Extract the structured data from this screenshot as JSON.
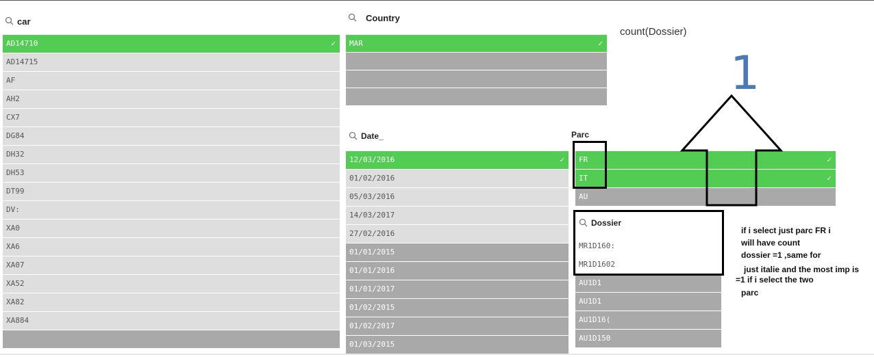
{
  "car": {
    "title": "car",
    "items": [
      {
        "label": "AD14710",
        "state": "selected"
      },
      {
        "label": "AD14715",
        "state": "alt"
      },
      {
        "label": "AF",
        "state": "alt"
      },
      {
        "label": "AH2",
        "state": "alt"
      },
      {
        "label": "CX7",
        "state": "alt"
      },
      {
        "label": "DG84",
        "state": "alt"
      },
      {
        "label": "DH32",
        "state": "alt"
      },
      {
        "label": "DH53",
        "state": "alt"
      },
      {
        "label": "DT99",
        "state": "alt"
      },
      {
        "label": "DV:",
        "state": "alt"
      },
      {
        "label": "XA0",
        "state": "alt"
      },
      {
        "label": "XA6",
        "state": "alt"
      },
      {
        "label": "XA07",
        "state": "alt"
      },
      {
        "label": "XA52",
        "state": "alt"
      },
      {
        "label": "XA82",
        "state": "alt"
      },
      {
        "label": "XA884",
        "state": "alt"
      },
      {
        "label": "",
        "state": "excluded"
      }
    ]
  },
  "country": {
    "title": "Country",
    "items": [
      {
        "label": "MAR",
        "state": "selected"
      },
      {
        "label": "",
        "state": "excluded"
      },
      {
        "label": "",
        "state": "excluded"
      },
      {
        "label": "",
        "state": "excluded"
      }
    ]
  },
  "date": {
    "title": "Date_",
    "items": [
      {
        "label": "12/03/2016",
        "state": "selected"
      },
      {
        "label": "01/02/2016",
        "state": "alt"
      },
      {
        "label": "05/03/2016",
        "state": "alt"
      },
      {
        "label": "14/03/2017",
        "state": "alt"
      },
      {
        "label": "27/02/2016",
        "state": "alt"
      },
      {
        "label": "01/01/2015",
        "state": "excluded"
      },
      {
        "label": "01/01/2016",
        "state": "excluded"
      },
      {
        "label": "01/01/2017",
        "state": "excluded"
      },
      {
        "label": "01/02/2015",
        "state": "excluded"
      },
      {
        "label": "01/02/2017",
        "state": "excluded"
      },
      {
        "label": "01/03/2015",
        "state": "excluded"
      }
    ]
  },
  "parc": {
    "title": "Parc",
    "items": [
      {
        "label": "FR",
        "state": "selected"
      },
      {
        "label": "IT",
        "state": "selected"
      },
      {
        "label": "AU",
        "state": "excluded"
      }
    ]
  },
  "dossier": {
    "title": "Dossier",
    "items": [
      {
        "label": "MR1D160:",
        "state": "white"
      },
      {
        "label": "MR1D1602",
        "state": "white"
      },
      {
        "label": "AU1D1",
        "state": "excluded"
      },
      {
        "label": "AU1D1",
        "state": "excluded"
      },
      {
        "label": "AU1D16(",
        "state": "excluded"
      },
      {
        "label": "AU1D150",
        "state": "excluded"
      }
    ]
  },
  "kpi": {
    "label": "count(Dossier)",
    "value": "1"
  },
  "annotation": {
    "lines": [
      "if i select just parc FR i",
      "will have count",
      "dossier  =1 ,same for",
      "just italie and the most imp is",
      "=1 if i select the two",
      "parc"
    ]
  },
  "colors": {
    "selected": "#52cc52",
    "alt": "#dedede",
    "excluded": "#a9a9a9",
    "kpi": "#4a7ab8"
  }
}
